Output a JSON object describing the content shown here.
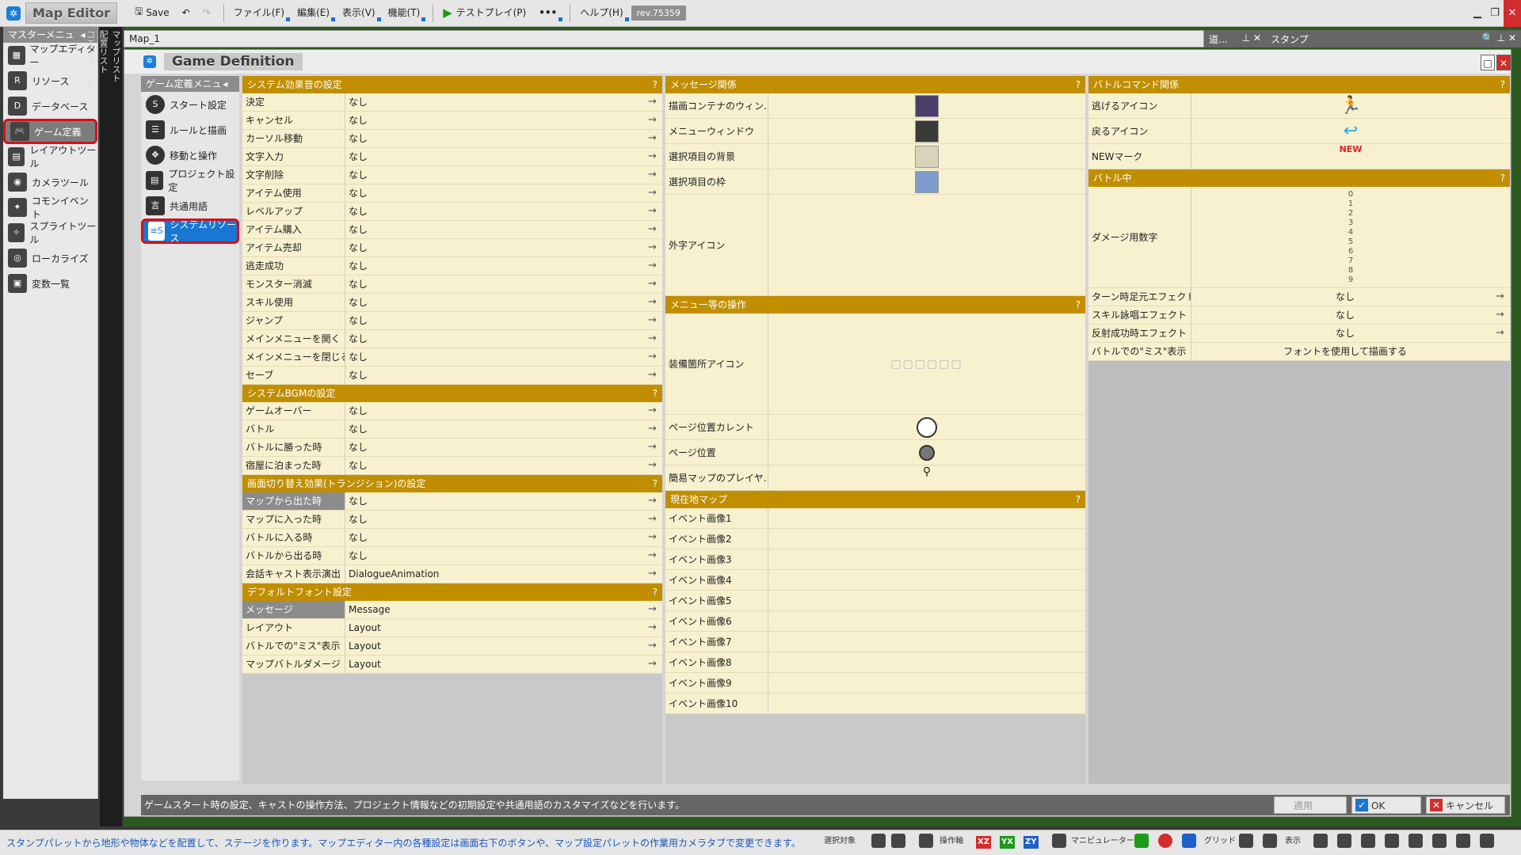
{
  "app": {
    "title": "Map Editor",
    "rev": "rev.75359"
  },
  "toolbar": {
    "save": "Save",
    "menus": [
      "ファイル(F)",
      "編集(E)",
      "表示(V)",
      "機能(T)"
    ],
    "testplay": "テストプレイ(P)",
    "help": "ヘルプ(H)"
  },
  "master_menu": {
    "title": "マスターメニュー",
    "items": [
      {
        "label": "マップエディター",
        "icon": "map-editor-icon"
      },
      {
        "label": "リソース",
        "icon": "resource-icon"
      },
      {
        "label": "データベース",
        "icon": "database-icon"
      },
      {
        "label": "ゲーム定義",
        "icon": "gamepad-icon",
        "selected": true
      },
      {
        "label": "レイアウトツール",
        "icon": "layout-icon"
      },
      {
        "label": "カメラツール",
        "icon": "camera-icon"
      },
      {
        "label": "コモンイベント",
        "icon": "common-event-icon"
      },
      {
        "label": "スプライトツール",
        "icon": "sprite-icon"
      },
      {
        "label": "ローカライズ",
        "icon": "localize-icon"
      },
      {
        "label": "変数一覧",
        "icon": "variables-icon"
      }
    ]
  },
  "vertical_tabs": {
    "map_list": "マップリスト",
    "placement_list": "配置リスト",
    "common_event": "コモンイベント"
  },
  "map_tab": "Map_1",
  "panel_tool": "道...",
  "panel_stamp": "スタンプ",
  "dialog": {
    "title": "Game Definition",
    "menu_title": "ゲーム定義メニュー",
    "menu": [
      {
        "label": "スタート設定"
      },
      {
        "label": "ルールと描画"
      },
      {
        "label": "移動と操作"
      },
      {
        "label": "プロジェクト設定"
      },
      {
        "label": "共通用語"
      },
      {
        "label": "システムリソース",
        "selected": true
      }
    ],
    "status": "ゲームスタート時の設定、キャストの操作方法、プロジェクト情報などの初期設定や共通用語のカスタマイズなどを行います。",
    "buttons": {
      "apply": "適用",
      "ok": "OK",
      "cancel": "キャンセル"
    }
  },
  "col1": {
    "sections": [
      {
        "title": "システム効果音の設定",
        "rows": [
          {
            "k": "決定",
            "v": "なし"
          },
          {
            "k": "キャンセル",
            "v": "なし"
          },
          {
            "k": "カーソル移動",
            "v": "なし"
          },
          {
            "k": "文字入力",
            "v": "なし"
          },
          {
            "k": "文字削除",
            "v": "なし"
          },
          {
            "k": "アイテム使用",
            "v": "なし"
          },
          {
            "k": "レベルアップ",
            "v": "なし"
          },
          {
            "k": "アイテム購入",
            "v": "なし"
          },
          {
            "k": "アイテム売却",
            "v": "なし"
          },
          {
            "k": "逃走成功",
            "v": "なし"
          },
          {
            "k": "モンスター消滅",
            "v": "なし"
          },
          {
            "k": "スキル使用",
            "v": "なし"
          },
          {
            "k": "ジャンプ",
            "v": "なし"
          },
          {
            "k": "メインメニューを開く",
            "v": "なし"
          },
          {
            "k": "メインメニューを閉じる",
            "v": "なし"
          },
          {
            "k": "セーブ",
            "v": "なし"
          }
        ]
      },
      {
        "title": "システムBGMの設定",
        "rows": [
          {
            "k": "ゲームオーバー",
            "v": "なし"
          },
          {
            "k": "バトル",
            "v": "なし"
          },
          {
            "k": "バトルに勝った時",
            "v": "なし"
          },
          {
            "k": "宿屋に泊まった時",
            "v": "なし"
          }
        ]
      },
      {
        "title": "画面切り替え効果(トランジション)の設定",
        "rows": [
          {
            "k": "マップから出た時",
            "v": "なし",
            "g": true
          },
          {
            "k": "マップに入った時",
            "v": "なし"
          },
          {
            "k": "バトルに入る時",
            "v": "なし"
          },
          {
            "k": "バトルから出る時",
            "v": "なし"
          },
          {
            "k": "会話キャスト表示演出",
            "v": "DialogueAnimation"
          }
        ]
      },
      {
        "title": "デフォルトフォント設定",
        "rows": [
          {
            "k": "メッセージ",
            "v": "Message",
            "g": true
          },
          {
            "k": "レイアウト",
            "v": "Layout"
          },
          {
            "k": "バトルでの\"ミス\"表示",
            "v": "Layout"
          },
          {
            "k": "マップバトルダメージ",
            "v": "Layout"
          }
        ]
      }
    ]
  },
  "col2": {
    "message_title": "メッセージ関係",
    "message_rows": [
      {
        "k": "描画コンテナのウィン…",
        "color": "#4a3f6b"
      },
      {
        "k": "メニューウィンドウ",
        "color": "#3a3a38"
      },
      {
        "k": "選択項目の背景",
        "color": "#d8d4bc"
      },
      {
        "k": "選択項目の枠",
        "color": "#7d9ccc"
      }
    ],
    "gaiji": "外字アイコン",
    "menu_ops_title": "メニュー等の操作",
    "menu_ops": [
      "装備箇所アイコン",
      "ページ位置カレント",
      "ページ位置",
      "簡易マップのプレイヤ…"
    ],
    "current_map_title": "現在地マップ",
    "events": [
      "イベント画像1",
      "イベント画像2",
      "イベント画像3",
      "イベント画像4",
      "イベント画像5",
      "イベント画像6",
      "イベント画像7",
      "イベント画像8",
      "イベント画像9",
      "イベント画像10"
    ]
  },
  "col3": {
    "battle_cmd_title": "バトルコマンド関係",
    "battle_cmd": [
      "逃げるアイコン",
      "戻るアイコン",
      "NEWマーク"
    ],
    "new_label": "NEW",
    "in_battle_title": "バトル中",
    "damage_label": "ダメージ用数字",
    "digits": [
      "0",
      "1",
      "2",
      "3",
      "4",
      "5",
      "6",
      "7",
      "8",
      "9"
    ],
    "rows": [
      {
        "k": "ターン時足元エフェクト",
        "v": "なし"
      },
      {
        "k": "スキル詠唱エフェクト",
        "v": "なし"
      },
      {
        "k": "反射成功時エフェクト",
        "v": "なし"
      },
      {
        "k": "バトルでの\"ミス\"表示",
        "v": "フォントを使用して描画する"
      }
    ]
  },
  "bottom": {
    "hint": "スタンプパレットから地形や物体などを配置して、ステージを作ります。マップエディター内の各種設定は画面右下のボタンや、マップ設定パレットの作業用カメラタブで変更できます。",
    "labels": [
      "選択対象",
      "操作軸",
      "マニピュレーター",
      "グリッド",
      "表示"
    ],
    "axes": [
      "XZ",
      "YX",
      "ZY"
    ]
  }
}
